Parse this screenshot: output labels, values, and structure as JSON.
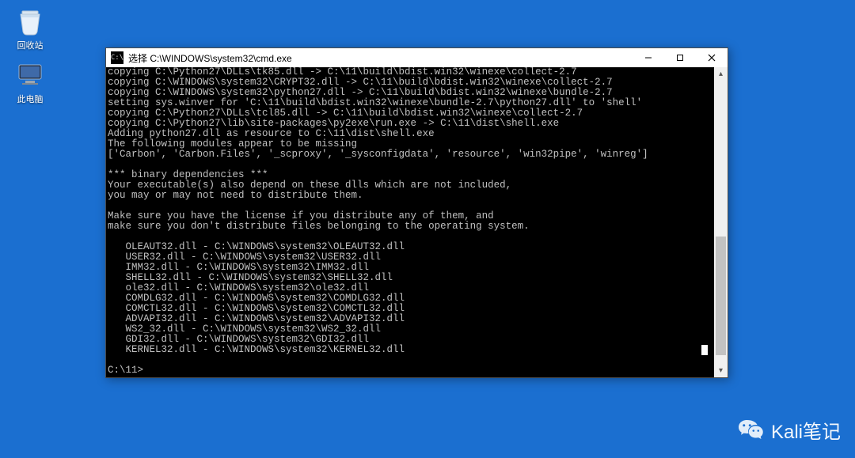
{
  "desktop": {
    "recycle_label": "回收站",
    "thispc_label": "此电脑"
  },
  "window": {
    "title": "选择 C:\\WINDOWS\\system32\\cmd.exe",
    "minimize_tip": "Minimize",
    "maximize_tip": "Maximize",
    "close_tip": "Close"
  },
  "terminal_lines": [
    "copying C:\\Python27\\DLLs\\tk85.dll -> C:\\11\\build\\bdist.win32\\winexe\\collect-2.7",
    "copying C:\\WINDOWS\\system32\\CRYPT32.dll -> C:\\11\\build\\bdist.win32\\winexe\\collect-2.7",
    "copying C:\\WINDOWS\\system32\\python27.dll -> C:\\11\\build\\bdist.win32\\winexe\\bundle-2.7",
    "setting sys.winver for 'C:\\11\\build\\bdist.win32\\winexe\\bundle-2.7\\python27.dll' to 'shell'",
    "copying C:\\Python27\\DLLs\\tcl85.dll -> C:\\11\\build\\bdist.win32\\winexe\\collect-2.7",
    "copying C:\\Python27\\lib\\site-packages\\py2exe\\run.exe -> C:\\11\\dist\\shell.exe",
    "Adding python27.dll as resource to C:\\11\\dist\\shell.exe",
    "The following modules appear to be missing",
    "['Carbon', 'Carbon.Files', '_scproxy', '_sysconfigdata', 'resource', 'win32pipe', 'winreg']",
    "",
    "*** binary dependencies ***",
    "Your executable(s) also depend on these dlls which are not included,",
    "you may or may not need to distribute them.",
    "",
    "Make sure you have the license if you distribute any of them, and",
    "make sure you don't distribute files belonging to the operating system.",
    "",
    "   OLEAUT32.dll - C:\\WINDOWS\\system32\\OLEAUT32.dll",
    "   USER32.dll - C:\\WINDOWS\\system32\\USER32.dll",
    "   IMM32.dll - C:\\WINDOWS\\system32\\IMM32.dll",
    "   SHELL32.dll - C:\\WINDOWS\\system32\\SHELL32.dll",
    "   ole32.dll - C:\\WINDOWS\\system32\\ole32.dll",
    "   COMDLG32.dll - C:\\WINDOWS\\system32\\COMDLG32.dll",
    "   COMCTL32.dll - C:\\WINDOWS\\system32\\COMCTL32.dll",
    "   ADVAPI32.dll - C:\\WINDOWS\\system32\\ADVAPI32.dll",
    "   WS2_32.dll - C:\\WINDOWS\\system32\\WS2_32.dll",
    "   GDI32.dll - C:\\WINDOWS\\system32\\GDI32.dll"
  ],
  "terminal_last_line_prefix": "   KERNEL32.dll - C:\\WINDOWS\\system32\\KERNEL32.dll",
  "terminal_prompt": "C:\\11>",
  "watermark_text": "Kali笔记"
}
